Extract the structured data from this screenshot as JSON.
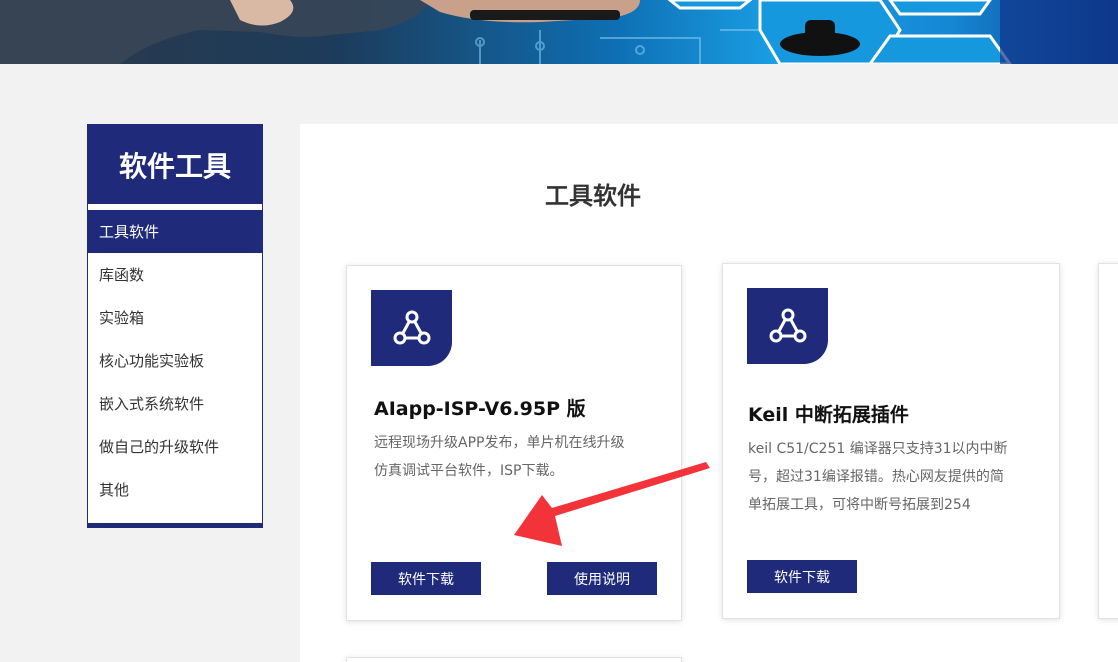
{
  "sidebar": {
    "title": "软件工具",
    "items": [
      {
        "label": "工具软件",
        "active": true
      },
      {
        "label": "库函数"
      },
      {
        "label": "实验箱"
      },
      {
        "label": "核心功能实验板"
      },
      {
        "label": "嵌入式系统软件"
      },
      {
        "label": "做自己的升级软件"
      },
      {
        "label": "其他"
      }
    ]
  },
  "main": {
    "title": "工具软件",
    "cards": [
      {
        "icon": "share-nodes-icon",
        "title": "AIapp-ISP-V6.95P 版",
        "desc_line1": "远程现场升级APP发布，单片机在线升级",
        "desc_line2": "仿真调试平台软件，ISP下载。",
        "download_label": "软件下载",
        "manual_label": "使用说明"
      },
      {
        "icon": "share-nodes-icon",
        "title": "Keil 中断拓展插件",
        "desc_line1": "keil C51/C251 编译器只支持31以内中断",
        "desc_line2": "号，超过31编译报错。热心网友提供的简",
        "desc_line3": "单拓展工具，可将中断号拓展到254",
        "download_label": "软件下载"
      }
    ]
  },
  "colors": {
    "brand": "#1f2a7a",
    "annotation_arrow": "#f2333a"
  }
}
